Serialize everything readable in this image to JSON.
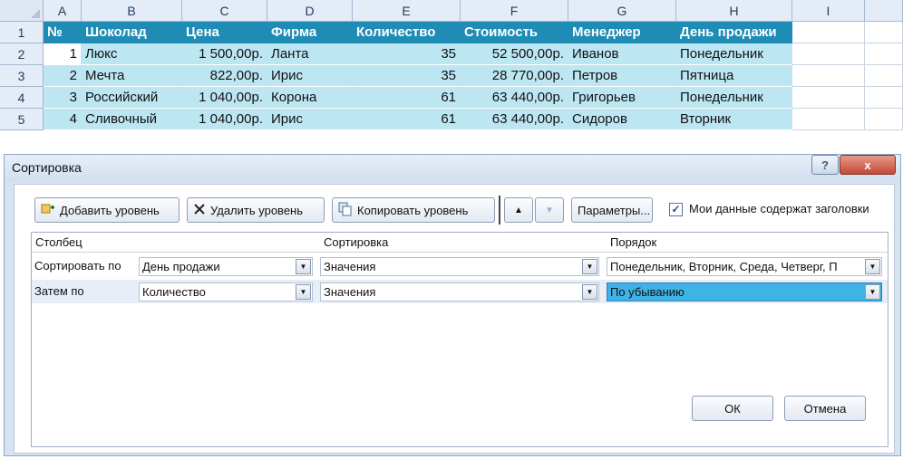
{
  "sheet": {
    "columns": [
      "A",
      "B",
      "C",
      "D",
      "E",
      "F",
      "G",
      "H",
      "I"
    ],
    "row_numbers": [
      "1",
      "2",
      "3",
      "4",
      "5"
    ],
    "header": [
      "№",
      "Шоколад",
      "Цена",
      "Фирма",
      "Количество",
      "Стоимость",
      "Менеджер",
      "День продажи"
    ],
    "rows": [
      [
        "1",
        "Люкс",
        "1 500,00р.",
        "Ланта",
        "35",
        "52 500,00р.",
        "Иванов",
        "Понедельник"
      ],
      [
        "2",
        "Мечта",
        "822,00р.",
        "Ирис",
        "35",
        "28 770,00р.",
        "Петров",
        "Пятница"
      ],
      [
        "3",
        "Российский",
        "1 040,00р.",
        "Корона",
        "61",
        "63 440,00р.",
        "Григорьев",
        "Понедельник"
      ],
      [
        "4",
        "Сливочный",
        "1 040,00р.",
        "Ирис",
        "61",
        "63 440,00р.",
        "Сидоров",
        "Вторник"
      ]
    ],
    "colors": {
      "header_bg": "#1e8cb5",
      "data_bg": "#bde6f3"
    }
  },
  "dialog": {
    "title": "Сортировка",
    "help_label": "?",
    "close_label": "x",
    "toolbar": {
      "add_level": "Добавить уровень",
      "delete_level": "Удалить уровень",
      "copy_level": "Копировать уровень",
      "move_up": "▲",
      "move_down": "▼",
      "options": "Параметры...",
      "headers_checked": "✓",
      "headers_label": "Мои данные содержат заголовки"
    },
    "grid": {
      "headers": {
        "column": "Столбец",
        "sort_on": "Сортировка",
        "order": "Порядок"
      },
      "rows": [
        {
          "label": "Сортировать по",
          "column": "День продажи",
          "sort_on": "Значения",
          "order": "Понедельник, Вторник, Среда, Четверг, П"
        },
        {
          "label": "Затем по",
          "column": "Количество",
          "sort_on": "Значения",
          "order": "По убыванию"
        }
      ]
    },
    "ok_label": "ОК",
    "cancel_label": "Отмена"
  },
  "icons": {
    "add": "add-level-icon",
    "delete": "delete-icon",
    "copy": "copy-icon",
    "dropdown": "▼"
  }
}
